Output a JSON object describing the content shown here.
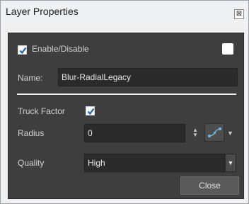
{
  "window": {
    "title": "Layer Properties",
    "close_glyph": "⊠"
  },
  "enable": {
    "label": "Enable/Disable",
    "checked": true
  },
  "color_swatch": {
    "color": "#ffffff"
  },
  "name": {
    "label": "Name:",
    "value": "Blur-RadialLegacy"
  },
  "truck_factor": {
    "label": "Truck Factor",
    "checked": true
  },
  "radius": {
    "label": "Radius",
    "value": "0",
    "spin_up": "▲",
    "spin_down": "▼",
    "fn_icon": "function-curve-icon",
    "menu_arrow": "▼"
  },
  "quality": {
    "label": "Quality",
    "value": "High",
    "arrow": "▼"
  },
  "buttons": {
    "close_label": "Close"
  },
  "colors": {
    "checkbox_check": "#1c5fb5",
    "fn_curve": "#6fb6ea"
  }
}
